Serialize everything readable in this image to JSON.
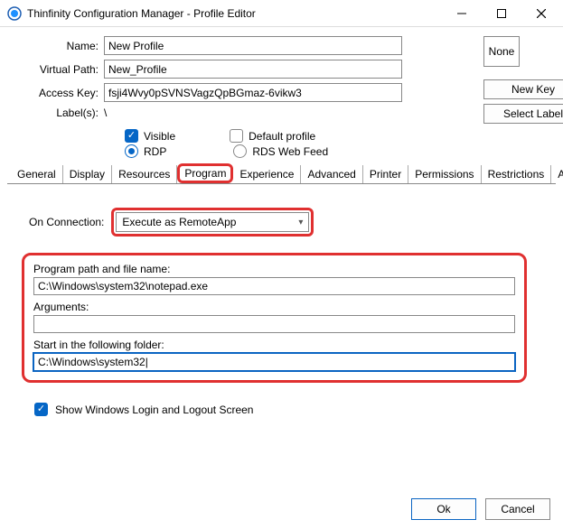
{
  "window": {
    "title": "Thinfinity Configuration Manager - Profile Editor"
  },
  "fields": {
    "name_label": "Name:",
    "name_value": "New Profile",
    "vpath_label": "Virtual Path:",
    "vpath_value": "New_Profile",
    "akey_label": "Access Key:",
    "akey_value": "fsji4Wvy0pSVNSVagzQpBGmaz-6vikw3",
    "labels_label": "Label(s):",
    "labels_value": "\\",
    "none_btn": "None",
    "newkey_btn": "New Key",
    "sellabel_btn": "Select Label"
  },
  "options": {
    "visible": "Visible",
    "default": "Default profile",
    "rdp": "RDP",
    "rds": "RDS Web Feed"
  },
  "tabs": [
    "General",
    "Display",
    "Resources",
    "Program",
    "Experience",
    "Advanced",
    "Printer",
    "Permissions",
    "Restrictions",
    "Access Hours"
  ],
  "program": {
    "onconn_label": "On Connection:",
    "onconn_value": "Execute as RemoteApp",
    "path_label": "Program path and file name:",
    "path_value": "C:\\Windows\\system32\\notepad.exe",
    "args_label": "Arguments:",
    "args_value": "",
    "startin_label": "Start in the following folder:",
    "startin_value": "C:\\Windows\\system32|",
    "showwin": "Show Windows Login and Logout Screen"
  },
  "footer": {
    "ok": "Ok",
    "cancel": "Cancel"
  }
}
